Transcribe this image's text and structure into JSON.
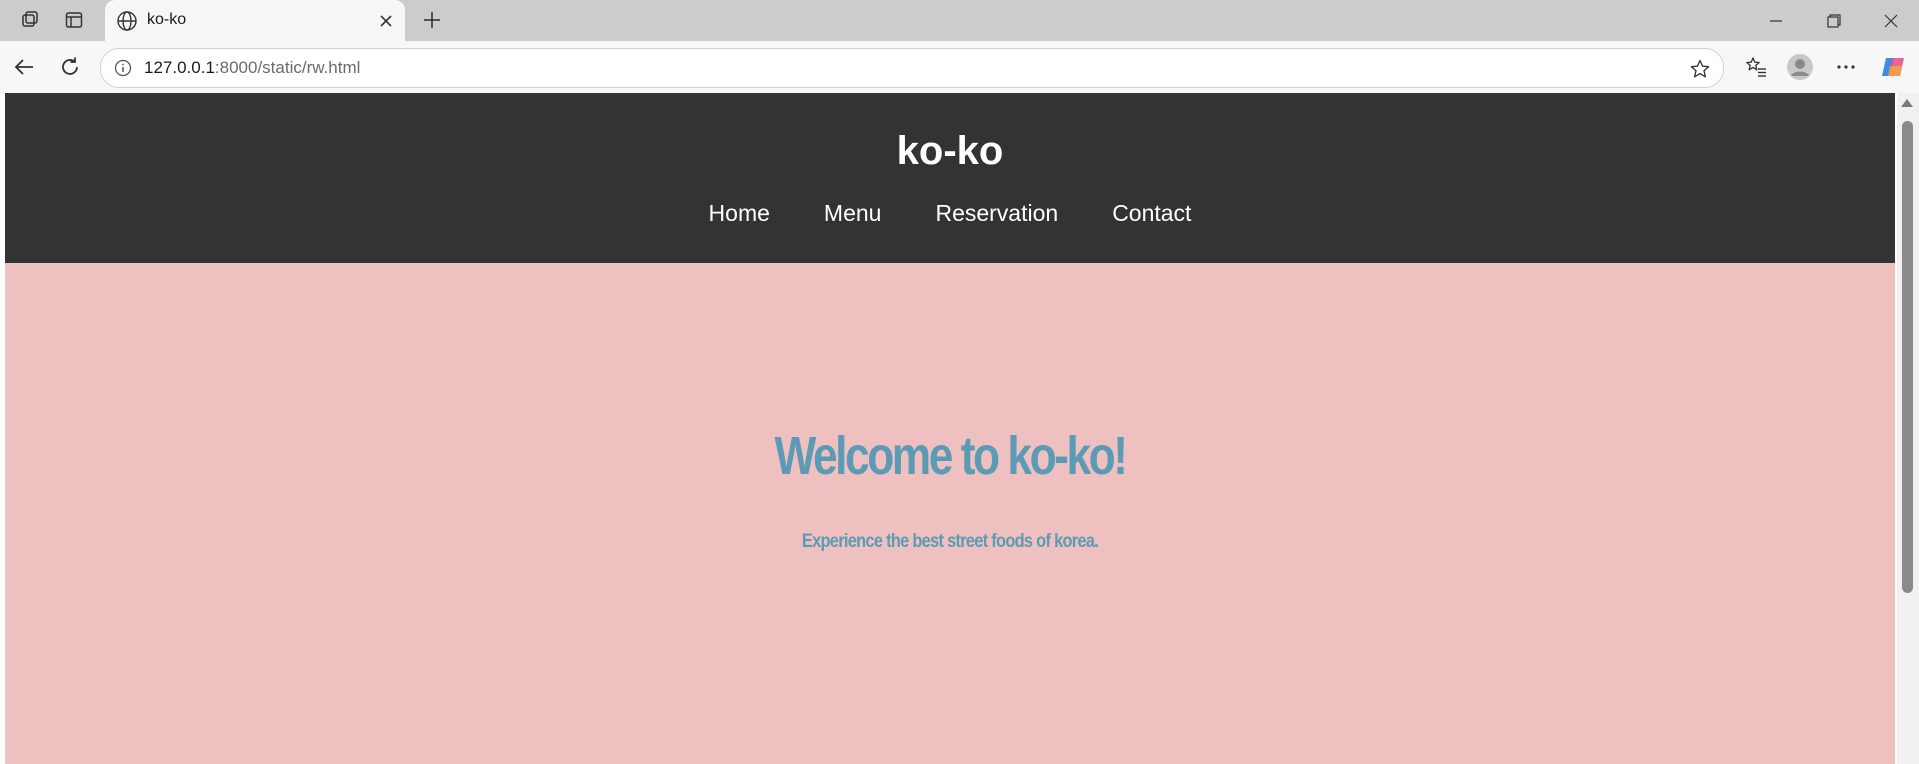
{
  "browser": {
    "tab": {
      "title": "ko-ko"
    },
    "address": {
      "host": "127.0.0.1",
      "rest": ":8000/static/rw.html"
    }
  },
  "site": {
    "title": "ko-ko",
    "nav": [
      "Home",
      "Menu",
      "Reservation",
      "Contact"
    ],
    "hero": {
      "title": "Welcome to ko-ko!",
      "subtitle": "Experience the best street foods of korea."
    }
  },
  "colors": {
    "header_bg": "#333333",
    "page_bg": "#eec0c0",
    "hero_text": "#5b9bb5"
  }
}
